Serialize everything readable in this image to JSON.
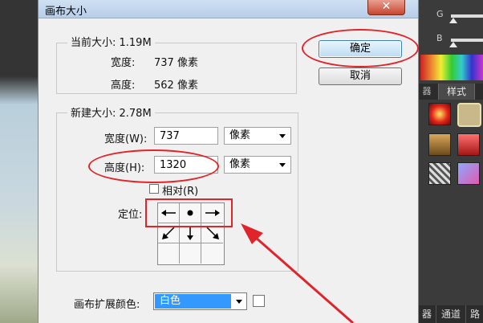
{
  "dialog": {
    "title": "画布大小",
    "close_glyph": "✕",
    "ok_label": "确定",
    "cancel_label": "取消"
  },
  "current_size": {
    "legend": "当前大小: 1.19M",
    "width_label": "宽度:",
    "width_value": "737 像素",
    "height_label": "高度:",
    "height_value": "562 像素"
  },
  "new_size": {
    "legend": "新建大小: 2.78M",
    "width_label": "宽度(W):",
    "width_value": "737",
    "width_unit": "像素",
    "height_label": "高度(H):",
    "height_value": "1320",
    "height_unit": "像素",
    "relative_label": "相对(R)",
    "relative_checked": false,
    "anchor_label": "定位:",
    "anchor_selected": "center"
  },
  "canvas_extension": {
    "label": "画布扩展颜色:",
    "value": "白色",
    "swatch_color": "#ffffff"
  },
  "right_panel": {
    "slider_g": "G",
    "slider_b": "B",
    "tab_styles": "样式",
    "tab_edge": "器",
    "bottom_tab_1": "器",
    "bottom_tab_2": "通道",
    "bottom_tab_3": "路"
  },
  "annotation_color": "#e0242b"
}
